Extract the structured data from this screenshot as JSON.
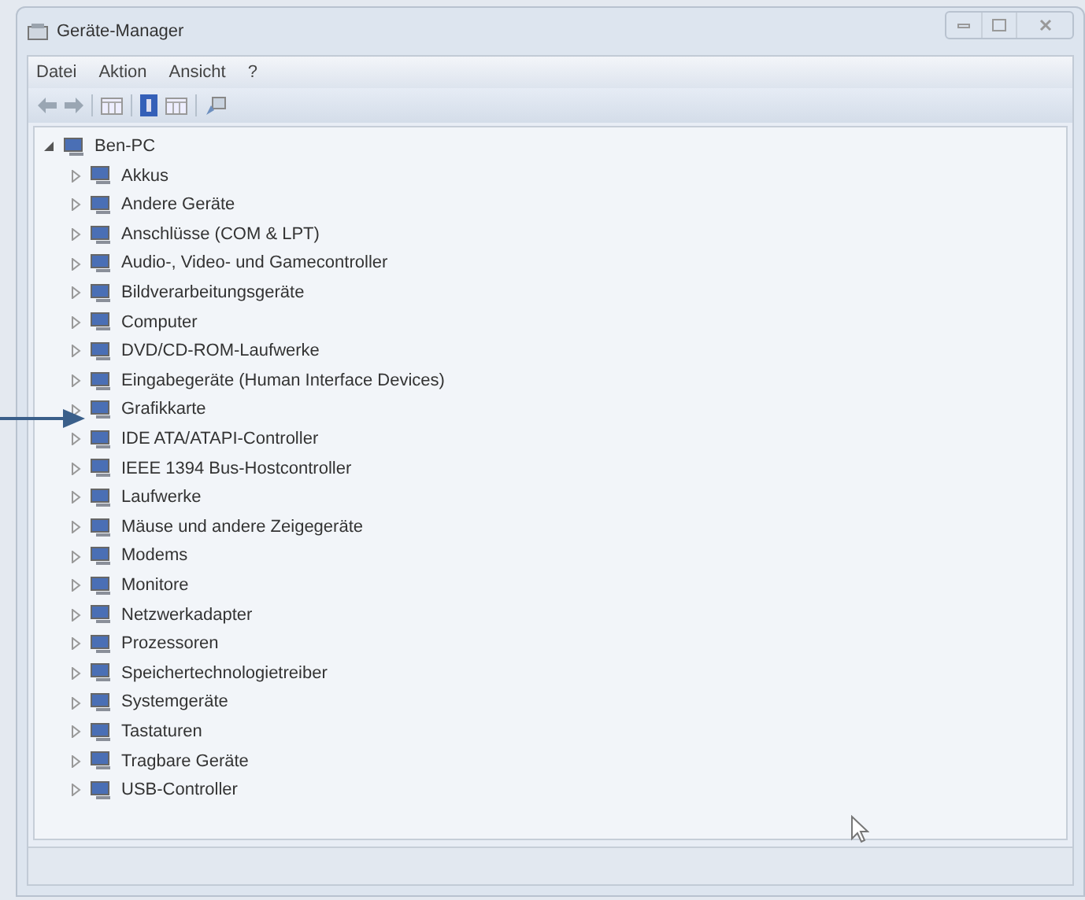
{
  "window": {
    "title": "Geräte-Manager"
  },
  "menu": [
    "Datei",
    "Aktion",
    "Ansicht",
    "?"
  ],
  "tree": {
    "label": "Ben-PC",
    "expanded": true,
    "children": [
      {
        "label": "Akkus",
        "expanded": false
      },
      {
        "label": "Andere Geräte",
        "expanded": false
      },
      {
        "label": "Anschlüsse (COM & LPT)",
        "expanded": false
      },
      {
        "label": "Audio-, Video- und Gamecontroller",
        "expanded": false
      },
      {
        "label": "Bildverarbeitungsgeräte",
        "expanded": false
      },
      {
        "label": "Computer",
        "expanded": false
      },
      {
        "label": "DVD/CD-ROM-Laufwerke",
        "expanded": false
      },
      {
        "label": "Eingabegeräte (Human Interface Devices)",
        "expanded": false
      },
      {
        "label": "Grafikkarte",
        "expanded": false
      },
      {
        "label": "IDE ATA/ATAPI-Controller",
        "expanded": false
      },
      {
        "label": "IEEE 1394 Bus-Hostcontroller",
        "expanded": false
      },
      {
        "label": "Laufwerke",
        "expanded": false
      },
      {
        "label": "Mäuse und andere Zeigegeräte",
        "expanded": false
      },
      {
        "label": "Modems",
        "expanded": false
      },
      {
        "label": "Monitore",
        "expanded": false
      },
      {
        "label": "Netzwerkadapter",
        "expanded": false
      },
      {
        "label": "Prozessoren",
        "expanded": false
      },
      {
        "label": "Speichertechnologietreiber",
        "expanded": false
      },
      {
        "label": "Systemgeräte",
        "expanded": false
      },
      {
        "label": "Tastaturen",
        "expanded": false
      },
      {
        "label": "Tragbare Geräte",
        "expanded": false
      },
      {
        "label": "USB-Controller",
        "expanded": false
      }
    ]
  }
}
